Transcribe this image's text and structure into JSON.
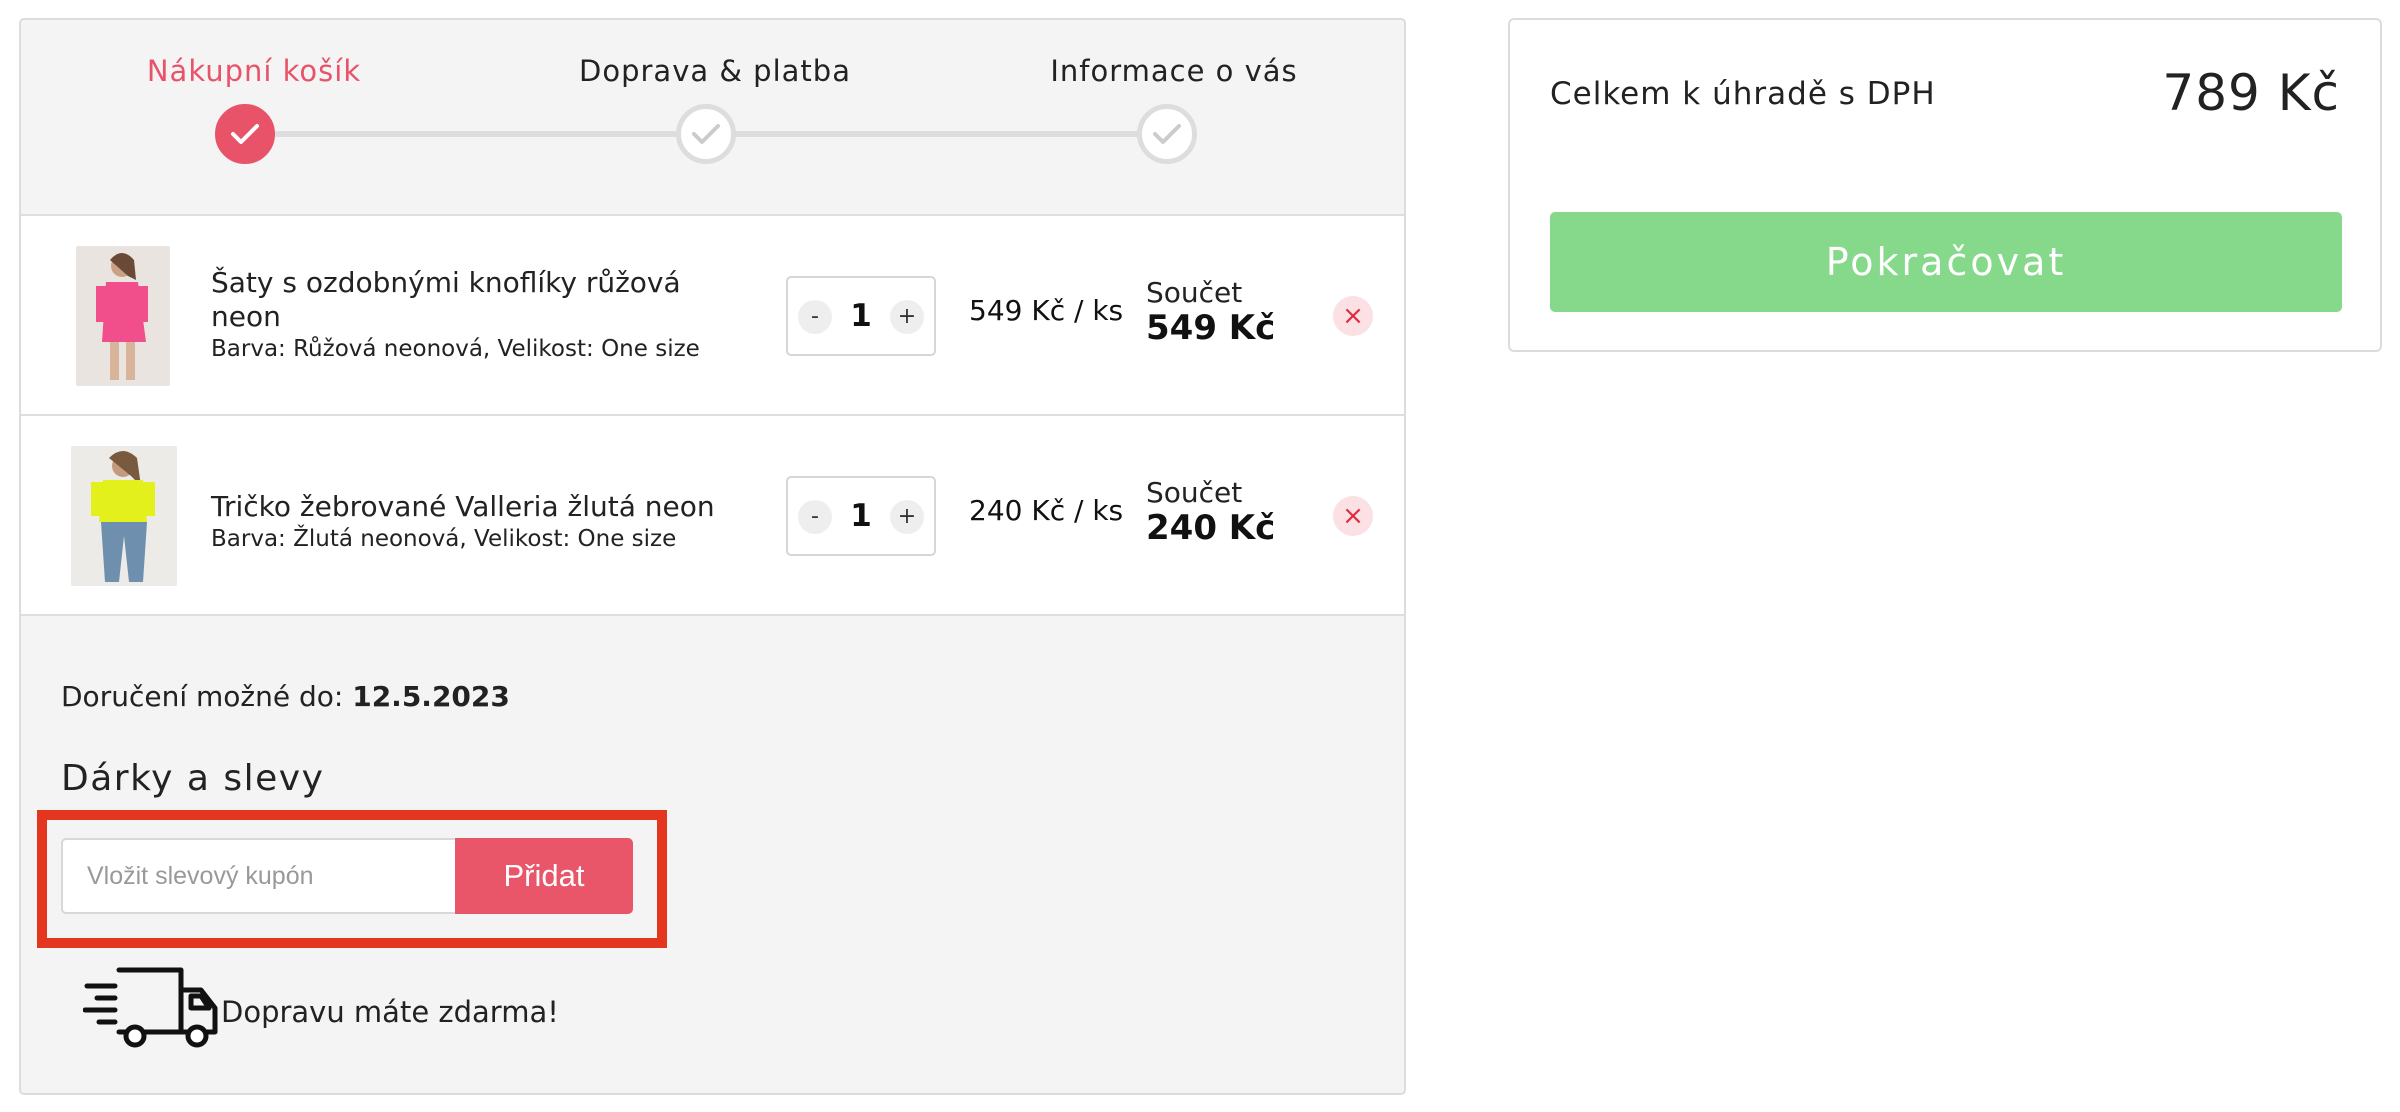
{
  "steps": [
    {
      "label": "Nákupní košík",
      "state": "active"
    },
    {
      "label": "Doprava & platba",
      "state": "inactive"
    },
    {
      "label": "Informace o vás",
      "state": "inactive"
    }
  ],
  "cart": {
    "items": [
      {
        "name": "Šaty s ozdobnými knoflíky růžová neon",
        "attributes": "Barva: Růžová neonová, Velikost: One size",
        "quantity": "1",
        "unit_price": "549 Kč / ks",
        "sum_label": "Součet",
        "sum_value": "549 Kč",
        "thumb_color": "#f04f8c"
      },
      {
        "name": "Tričko žebrované Valleria žlutá neon",
        "attributes": "Barva: Žlutá neonová, Velikost: One size",
        "quantity": "1",
        "unit_price": "240 Kč / ks",
        "sum_label": "Součet",
        "sum_value": "240 Kč",
        "thumb_color": "#e3f01c"
      }
    ],
    "qty_minus": "-",
    "qty_plus": "+",
    "remove_icon": "×"
  },
  "delivery": {
    "label": "Doručení možné do: ",
    "date": "12.5.2023"
  },
  "gifts": {
    "title": "Dárky a slevy",
    "coupon_placeholder": "Vložit slevový kupón",
    "coupon_button": "Přidat"
  },
  "shipping": {
    "free_text": "Dopravu máte zdarma!"
  },
  "summary": {
    "total_label": "Celkem k úhradě s DPH",
    "total_value": "789 Kč",
    "continue_label": "Pokračovat"
  },
  "colors": {
    "accent": "#e9536a",
    "continue": "#86d98a",
    "highlight": "#e4351f"
  }
}
